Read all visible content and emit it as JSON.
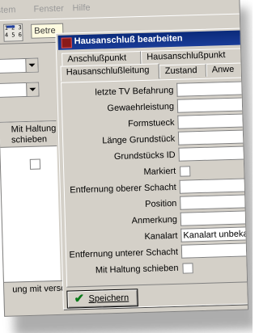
{
  "menu": {
    "item_system": "stem",
    "item_fenster": "Fenster",
    "item_hilfe": "Hilfe"
  },
  "toolbar": {
    "icon_text": "1 2 3\n4 5 6",
    "field_value": "Betre"
  },
  "grid": {
    "header": "Mit Haltung schieben"
  },
  "status": {
    "text": "ung mit versch"
  },
  "dialog": {
    "title": "Hausanschluß bearbeiten",
    "tabs_row1": [
      "Anschlußpunkt",
      "Hausanschlußpunkt"
    ],
    "tabs_row2": [
      "Hausanschlußleitung",
      "Zustand",
      "Anwe"
    ],
    "fields": [
      {
        "label": "letzte TV Befahrung",
        "type": "text",
        "value": ""
      },
      {
        "label": "Gewaehrleistung",
        "type": "text",
        "value": ""
      },
      {
        "label": "Formstueck",
        "type": "text",
        "value": ""
      },
      {
        "label": "Länge Grundstück",
        "type": "text",
        "value": ""
      },
      {
        "label": "Grundstücks ID",
        "type": "text",
        "value": ""
      },
      {
        "label": "Markiert",
        "type": "checkbox",
        "value": ""
      },
      {
        "label": "Entfernung oberer Schacht",
        "type": "text",
        "value": ""
      },
      {
        "label": "Position",
        "type": "text",
        "value": ""
      },
      {
        "label": "Anmerkung",
        "type": "text",
        "value": ""
      },
      {
        "label": "Kanalart",
        "type": "text",
        "value": "Kanalart unbeka"
      },
      {
        "label": "Entfernung unterer Schacht",
        "type": "text",
        "value": ""
      },
      {
        "label": "Mit Haltung schieben",
        "type": "checkbox",
        "value": ""
      }
    ],
    "save_label": "Speichern"
  }
}
